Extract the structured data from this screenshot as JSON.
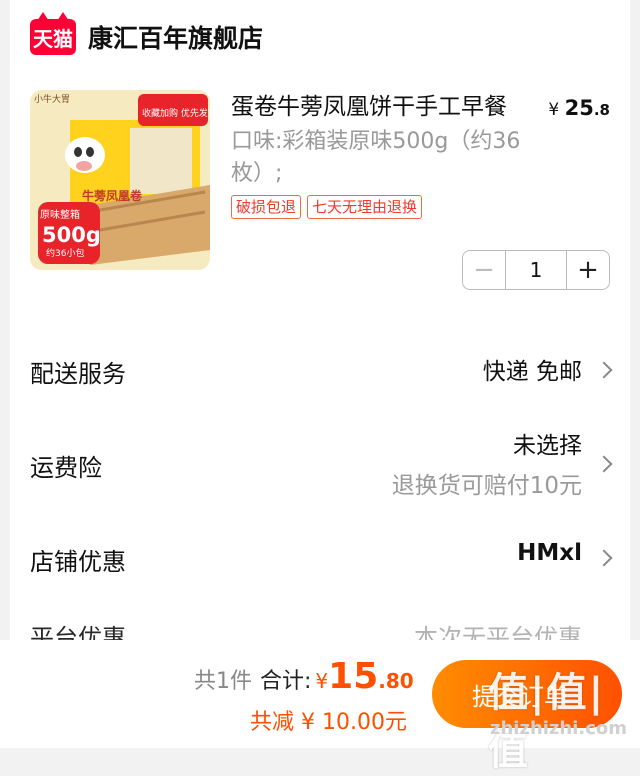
{
  "store": {
    "badge": "天猫",
    "name": "康汇百年旗舰店"
  },
  "product": {
    "title": "蛋卷牛蒡凤凰饼干手工早餐",
    "price_currency": "¥",
    "price_int": "25",
    "price_dec": ".8",
    "spec": "口味:彩箱装原味500g（约36枚）;",
    "tags": [
      "破损包退",
      "七天无理由退换"
    ],
    "image_texts": {
      "badge": "500g",
      "badge_sub": "约36小包",
      "top_label": "原味整箱",
      "box_label": "牛蒡凤凰卷",
      "promo": "收藏加购 优先发货",
      "brand": "小牛大胃"
    }
  },
  "stepper": {
    "minus": "−",
    "qty": "1",
    "plus": "+"
  },
  "rows": [
    {
      "label": "配送服务",
      "value": "快递 免邮"
    },
    {
      "label": "运费险",
      "value": "未选择",
      "sub": "退换货可赔付10元"
    },
    {
      "label": "店铺优惠",
      "value": "HMxl"
    }
  ],
  "partial_row": {
    "label": "平台优惠",
    "value": "本次无平台优惠"
  },
  "footer": {
    "count": "共1件",
    "total_label": "合计:",
    "currency": "¥",
    "total_int": "15",
    "total_dec": ".80",
    "saved": "共减 ¥ 10.00元",
    "submit": "提交订单"
  },
  "watermark": {
    "main": "值|值|值",
    "site": "zhizhizhi.com"
  },
  "colors": {
    "accent": "#ff5000",
    "tmall": "#ff0036",
    "tag_border": "#f26b3c"
  }
}
